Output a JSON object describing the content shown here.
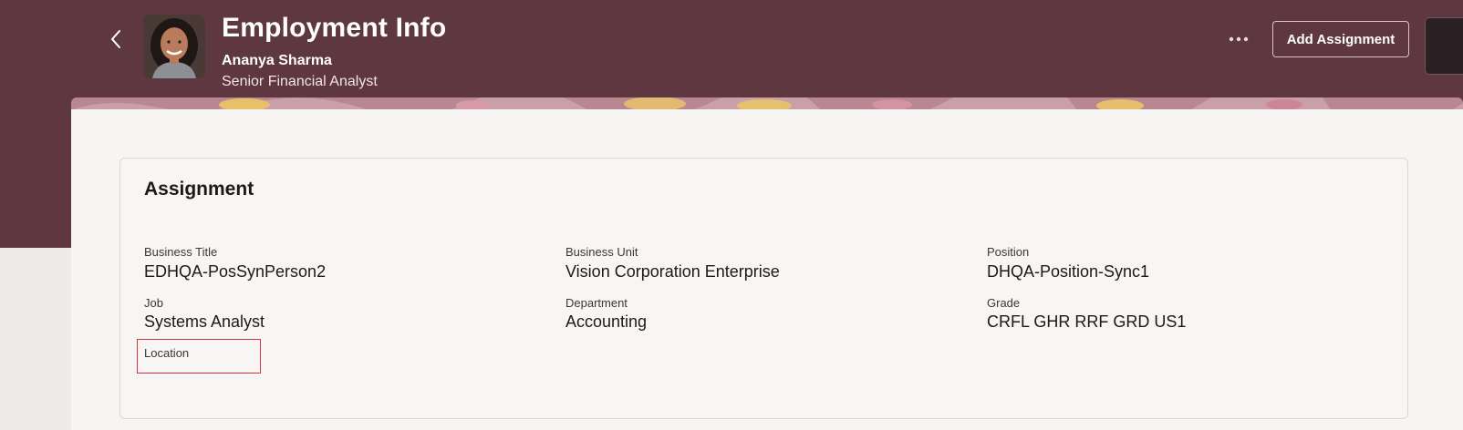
{
  "header": {
    "title": "Employment Info",
    "person_name": "Ananya Sharma",
    "person_role": "Senior Financial Analyst",
    "add_button_label": "Add Assignment",
    "more_icon": "more-horizontal-icon",
    "back_icon": "chevron-left-icon"
  },
  "assignment": {
    "section_title": "Assignment",
    "fields": {
      "business_title": {
        "label": "Business Title",
        "value": "EDHQA-PosSynPerson2"
      },
      "business_unit": {
        "label": "Business Unit",
        "value": "Vision Corporation Enterprise"
      },
      "position": {
        "label": "Position",
        "value": "DHQA-Position-Sync1"
      },
      "job": {
        "label": "Job",
        "value": "Systems Analyst"
      },
      "department": {
        "label": "Department",
        "value": "Accounting"
      },
      "grade": {
        "label": "Grade",
        "value": "CRFL GHR RRF GRD US1"
      },
      "location": {
        "label": "Location",
        "value": ""
      }
    }
  },
  "colors": {
    "header_background": "#5e3741",
    "panel_background": "#f7f5f4",
    "highlight_border": "#d6333f"
  }
}
